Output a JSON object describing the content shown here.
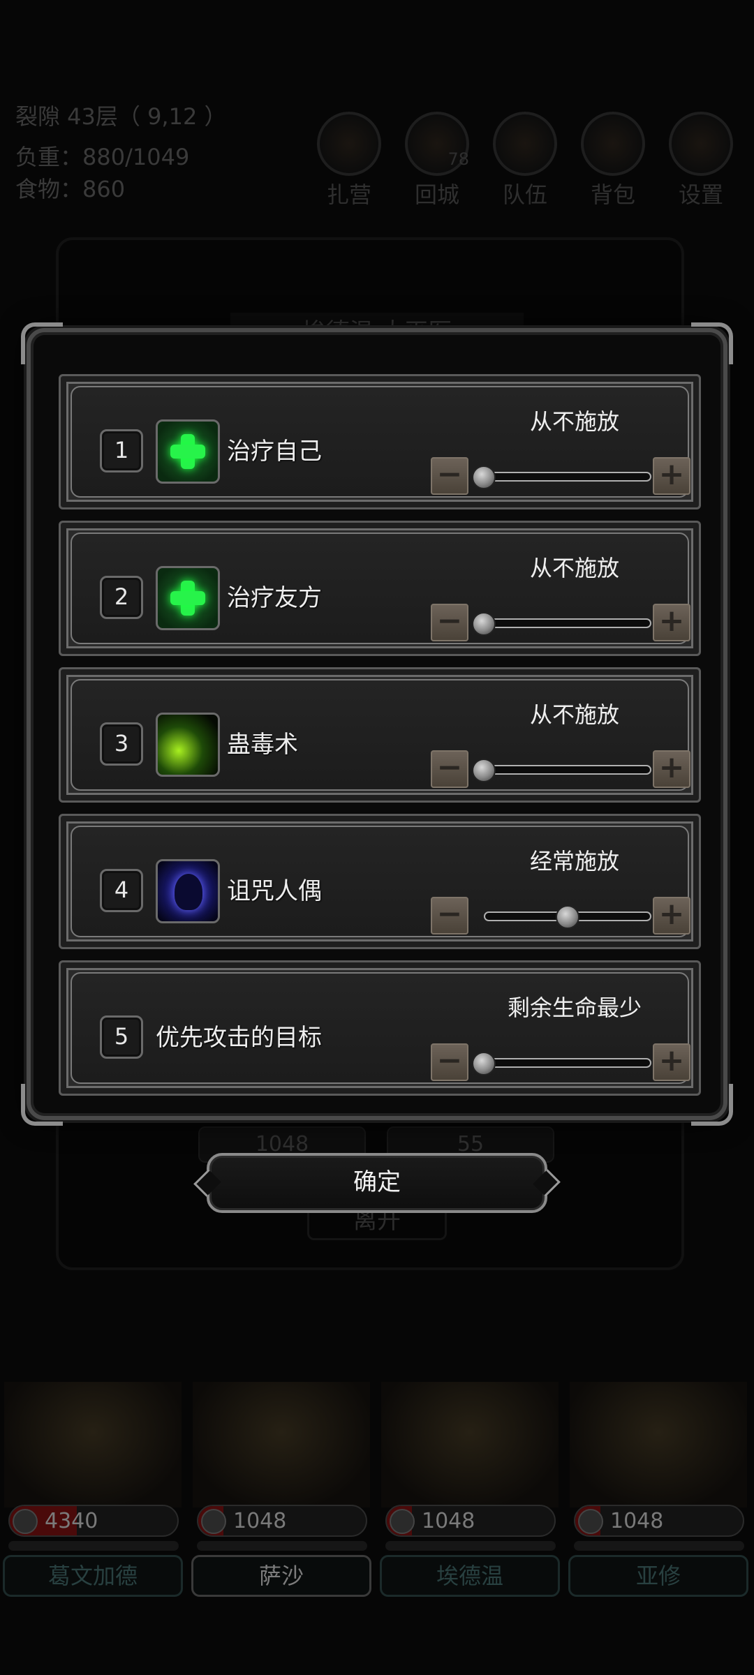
{
  "hud": {
    "floor": "裂隙 43层（ 9,12 ）",
    "load": "负重：880/1049",
    "food": "食物：860"
  },
  "top_menu": [
    {
      "label": "扎营",
      "icon": "camp-icon",
      "badge": ""
    },
    {
      "label": "回城",
      "icon": "town-portal-icon",
      "badge": "78"
    },
    {
      "label": "队伍",
      "icon": "team-icon",
      "badge": ""
    },
    {
      "label": "背包",
      "icon": "backpack-icon",
      "badge": ""
    },
    {
      "label": "设置",
      "icon": "gear-icon",
      "badge": ""
    }
  ],
  "background_panel": {
    "hero_name": "埃德温·大巫医",
    "hp": "1048",
    "energy": "55",
    "leave_label": "离开"
  },
  "dialog": {
    "rows": [
      {
        "number": "1",
        "icon": "heal-self-icon",
        "name": "治疗自己",
        "frequency": "从不施放",
        "level": 0
      },
      {
        "number": "2",
        "icon": "heal-ally-icon",
        "name": "治疗友方",
        "frequency": "从不施放",
        "level": 0
      },
      {
        "number": "3",
        "icon": "poison-icon",
        "name": "蛊毒术",
        "frequency": "从不施放",
        "level": 0
      },
      {
        "number": "4",
        "icon": "curse-doll-icon",
        "name": "诅咒人偶",
        "frequency": "经常施放",
        "level": 0.5
      },
      {
        "number": "5",
        "icon": "",
        "name": "优先攻击的目标",
        "frequency": "剩余生命最少",
        "level": 0
      }
    ],
    "minus_symbol": "−",
    "plus_symbol": "+",
    "confirm_label": "确定"
  },
  "party": [
    {
      "name": "葛文加德",
      "hp": "4340",
      "hp_fraction": 0.4,
      "selected": false
    },
    {
      "name": "萨沙",
      "hp": "1048",
      "hp_fraction": 0.15,
      "selected": true
    },
    {
      "name": "埃德温",
      "hp": "1048",
      "hp_fraction": 0.15,
      "selected": false
    },
    {
      "name": "亚修",
      "hp": "1048",
      "hp_fraction": 0.15,
      "selected": false
    }
  ],
  "colors": {
    "heal_green": "#27f34a",
    "poison_green": "#a8f020",
    "curse_blue": "#3030c8",
    "frame_gray": "#7a7a7a"
  }
}
